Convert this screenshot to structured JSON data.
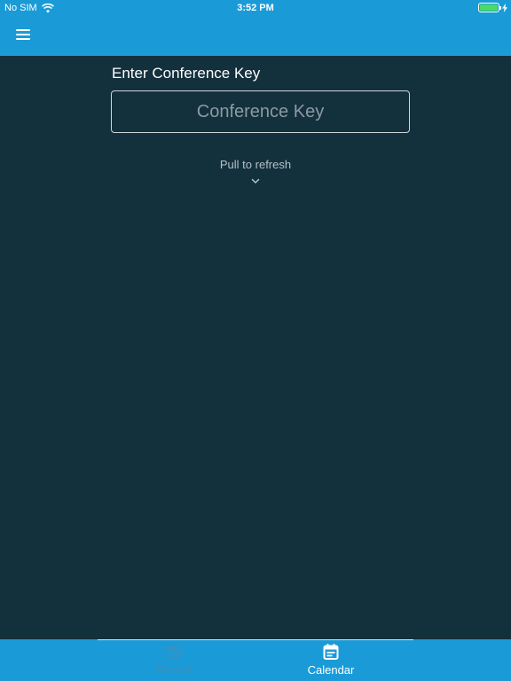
{
  "status_bar": {
    "carrier": "No SIM",
    "time": "3:52 PM",
    "wifi_icon": "wifi-icon",
    "battery_level": 1.0,
    "charging_icon": "bolt-icon",
    "colors": {
      "battery": "#4cd964"
    }
  },
  "nav": {
    "menu_icon": "hamburger-icon"
  },
  "conference": {
    "label": "Enter Conference Key",
    "placeholder": "Conference Key",
    "value": ""
  },
  "refresh": {
    "text": "Pull to refresh",
    "icon": "chevron-down-icon"
  },
  "tabs": [
    {
      "label": "Recent",
      "icon": "history-icon",
      "selected": false
    },
    {
      "label": "Calendar",
      "icon": "calendar-icon",
      "selected": true
    }
  ],
  "colors": {
    "accent": "#1a9bd7",
    "background": "#13303d",
    "inactive_tab": "#3c8fbd"
  }
}
